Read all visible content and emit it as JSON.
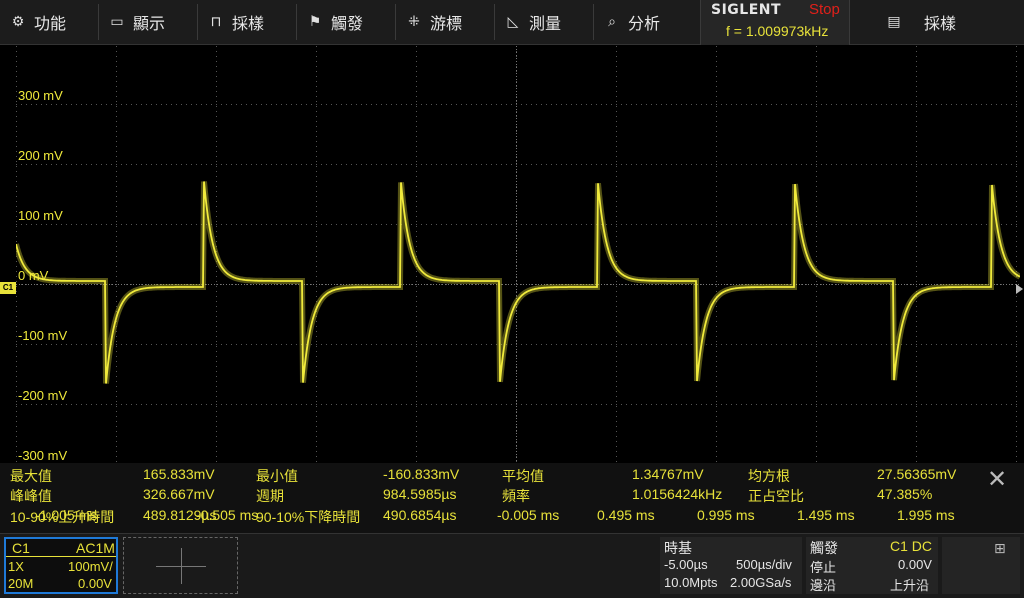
{
  "menu": {
    "items": [
      {
        "icon": "gear-icon",
        "glyph": "⚙",
        "label": "功能"
      },
      {
        "icon": "display-icon",
        "glyph": "▭",
        "label": "顯示"
      },
      {
        "icon": "acquire-icon",
        "glyph": "⊓",
        "label": "採樣"
      },
      {
        "icon": "trigger-flag-icon",
        "glyph": "⚑",
        "label": "觸發"
      },
      {
        "icon": "cursor-icon",
        "glyph": "⁜",
        "label": "游標"
      },
      {
        "icon": "measure-icon",
        "glyph": "◺",
        "label": "測量"
      },
      {
        "icon": "analyze-icon",
        "glyph": "⌕",
        "label": "分析"
      }
    ],
    "right_label": "採樣",
    "right_icon_glyph": "▤"
  },
  "brand": {
    "name": "SIGLENT",
    "run_state": "Stop",
    "frequency": "f = 1.009973kHz"
  },
  "grid": {
    "voltage_labels": [
      "300 mV",
      "200 mV",
      "100 mV",
      "0 mV",
      "-100 mV",
      "-200 mV",
      "-300 mV"
    ],
    "channel_marker": "C1"
  },
  "waveform": {
    "color": "#f0ea3c",
    "period_us": 984.5985,
    "peak_positive_mV": 165.833,
    "peak_negative_mV": -160.833,
    "baseline_mV": 0
  },
  "measurements": {
    "rows": [
      [
        {
          "label": "最大值",
          "value": "165.833mV"
        },
        {
          "label": "最小值",
          "value": "-160.833mV"
        },
        {
          "label": "平均值",
          "value": "1.34767mV"
        },
        {
          "label": "均方根",
          "value": "27.56365mV"
        }
      ],
      [
        {
          "label": "峰峰值",
          "value": "326.667mV"
        },
        {
          "label": "週期",
          "value": "984.5985µs"
        },
        {
          "label": "頻率",
          "value": "1.0156424kHz"
        },
        {
          "label": "正占空比",
          "value": "47.385%"
        }
      ],
      [
        {
          "label": "10-90%上升時間",
          "value": "489.8129µs"
        },
        {
          "label": "90-10%下降時間",
          "value": "490.6854µs"
        }
      ]
    ],
    "time_ticks": [
      "-1.005 ms",
      "-0.505 ms",
      "-0.005 ms",
      "0.495 ms",
      "0.995 ms",
      "1.495 ms",
      "1.995 ms"
    ],
    "close_glyph": "✕"
  },
  "channel1": {
    "name": "C1",
    "coupling": "AC1M",
    "probe": "1X",
    "scale": "100mV/",
    "bandwidth": "20M",
    "offset": "0.00V"
  },
  "timebase": {
    "title": "時基",
    "delay": "-5.00µs",
    "scale": "500µs/div",
    "memory": "10.0Mpts",
    "sample_rate": "2.00GSa/s"
  },
  "trigger": {
    "title": "觸發",
    "source": "C1 DC",
    "state": "停止",
    "level": "0.00V",
    "slope_label": "邊沿",
    "slope": "上升沿"
  },
  "network_icon_glyph": "⊞"
}
